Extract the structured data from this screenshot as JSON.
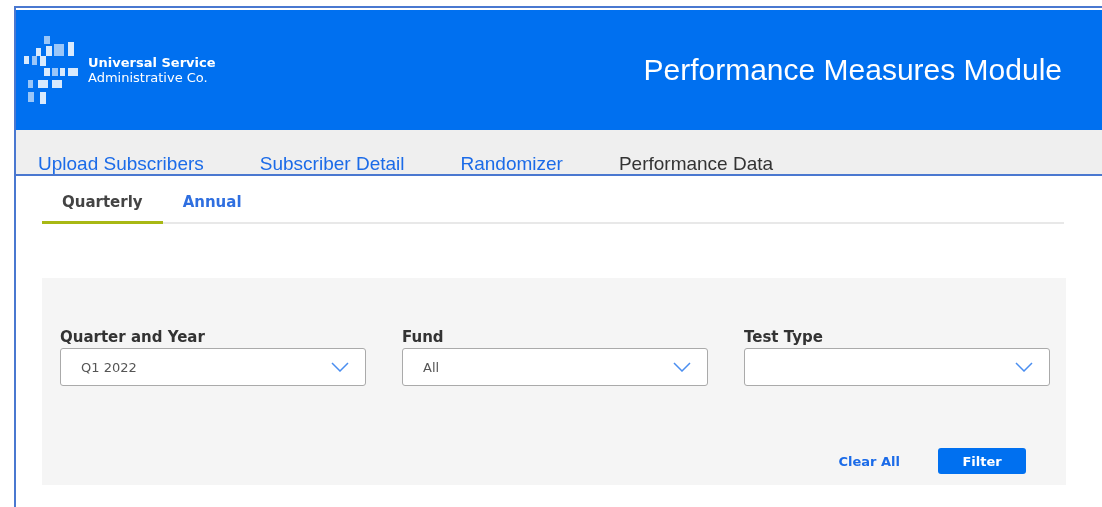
{
  "header": {
    "org_name": "Universal Service",
    "org_subtitle": "Administrative Co.",
    "title": "Performance Measures Module"
  },
  "nav_tabs": [
    {
      "label": "Upload Subscribers",
      "selected": false
    },
    {
      "label": "Subscriber Detail",
      "selected": false
    },
    {
      "label": "Randomizer",
      "selected": false
    },
    {
      "label": "Performance Data",
      "selected": true
    }
  ],
  "sub_tabs": [
    {
      "label": "Quarterly",
      "selected": true
    },
    {
      "label": "Annual",
      "selected": false
    }
  ],
  "filters": [
    {
      "label": "Quarter and Year",
      "value": "Q1 2022"
    },
    {
      "label": "Fund",
      "value": "All"
    },
    {
      "label": "Test Type"
    }
  ],
  "actions": {
    "clear": "Clear All",
    "submit": "Filter"
  }
}
